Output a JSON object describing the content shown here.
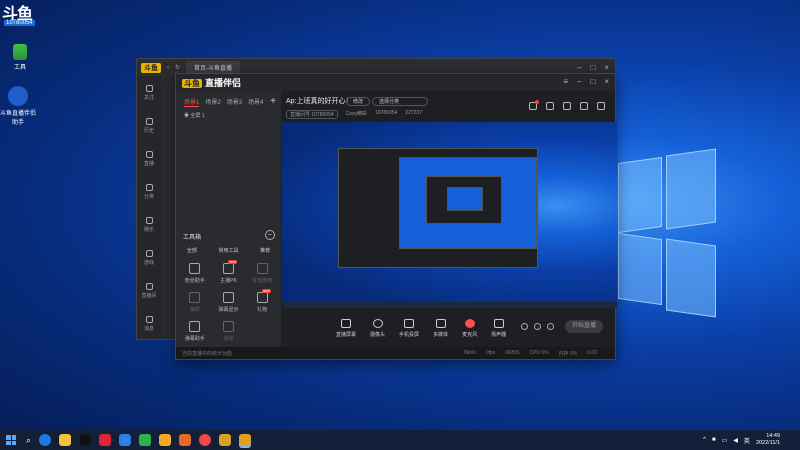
{
  "desktop": {
    "id_logo": "斗鱼",
    "id_number": "10780054",
    "icons": [
      {
        "label": "工具"
      },
      {
        "label": "斗鱼直播伴侣助手"
      }
    ]
  },
  "back_window": {
    "tab_label": "首页-斗鱼直播",
    "side": [
      "关注",
      "历史",
      "直播",
      "分类",
      "娱乐",
      "游戏",
      "直播间",
      "消息"
    ]
  },
  "app": {
    "logo_text": "直播伴侣",
    "logo_badge": "斗鱼",
    "tabs": [
      "场景1",
      "场景2",
      "场景3",
      "场景4"
    ],
    "active_tab_index": 0,
    "scene_name": "全屏 1",
    "tools_title": "工具箱",
    "tool_cats": [
      "全部",
      "常用工具",
      "推荐"
    ],
    "tools": [
      {
        "label": "粉丝助手",
        "new": false
      },
      {
        "label": "主播PK",
        "new": true
      },
      {
        "label": "互动游戏",
        "new": false
      },
      {
        "label": "抽奖",
        "new": false
      },
      {
        "label": "弹幕显示",
        "new": false
      },
      {
        "label": "礼物",
        "new": true
      },
      {
        "label": "弹幕助手",
        "new": false
      },
      {
        "label": "活动",
        "new": false
      }
    ],
    "title": "Ap:上班真的好开心！",
    "title_btn": "修改",
    "cat_btn": "选择分类",
    "sub_info": [
      "直播间号 10780054",
      "分区",
      "Cozy精彩",
      "10780054",
      "227237"
    ],
    "bottom": [
      {
        "label": "直播屏幕"
      },
      {
        "label": "摄像头"
      },
      {
        "label": "手机投屏"
      },
      {
        "label": "多媒体"
      },
      {
        "label": "麦克风",
        "red": true
      },
      {
        "label": "扬声器"
      }
    ],
    "start_label": "开始直播",
    "status_left": "当前直播中的统计功能",
    "stats": [
      "0kb/s",
      "0fps",
      "0KB/S",
      "CPU 0%",
      "内存 0%",
      "0.00"
    ]
  },
  "taskbar": {
    "clock_time": "14:49",
    "clock_date": "2022/11/1",
    "lang": "英"
  }
}
